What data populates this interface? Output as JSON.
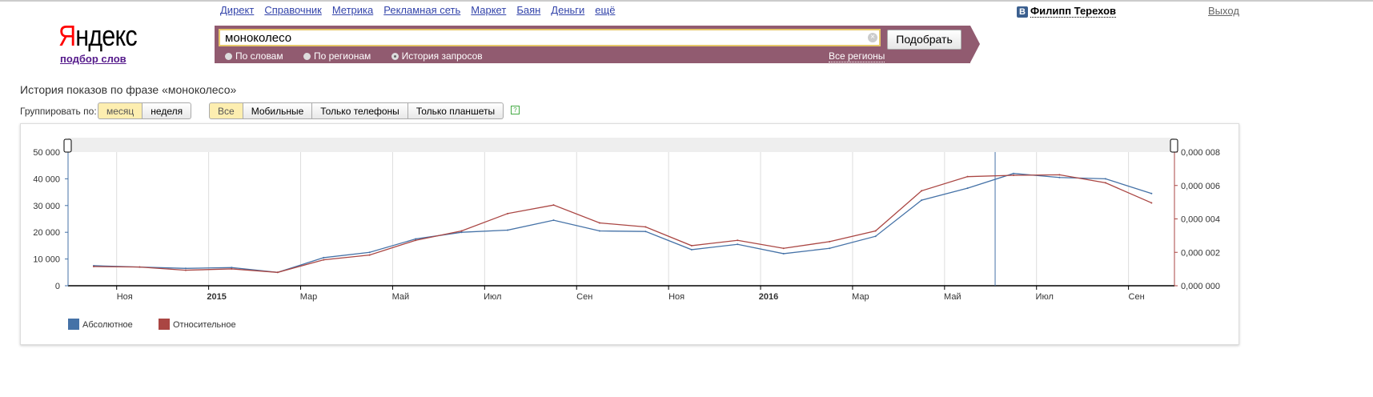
{
  "header": {
    "links": [
      "Директ",
      "Справочник",
      "Метрика",
      "Рекламная сеть",
      "Маркет",
      "Баян",
      "Деньги",
      "ещё"
    ],
    "logo": "Яндекс",
    "logo_first": "Я",
    "logo_rest": "ндекс",
    "subtitle": "подбор слов",
    "user": "Филипп Терехов",
    "vk_icon": "В",
    "logout": "Выход"
  },
  "search": {
    "value": "моноколесо",
    "button": "Подобрать",
    "clear_icon": "×",
    "modes": [
      {
        "label": "По словам",
        "selected": false
      },
      {
        "label": "По регионам",
        "selected": false
      },
      {
        "label": "История запросов",
        "selected": true
      }
    ],
    "regions": "Все регионы"
  },
  "page": {
    "title": "История показов по фразе «моноколесо»",
    "group_label": "Группировать по:",
    "group": [
      "месяц",
      "неделя"
    ],
    "devices": [
      "Все",
      "Мобильные",
      "Только телефоны",
      "Только планшеты"
    ],
    "help": "?"
  },
  "chart_data": {
    "type": "line",
    "x": [
      "2014-10",
      "2014-11",
      "2014-12",
      "2015-01",
      "2015-02",
      "2015-03",
      "2015-04",
      "2015-05",
      "2015-06",
      "2015-07",
      "2015-08",
      "2015-09",
      "2015-10",
      "2015-11",
      "2015-12",
      "2016-01",
      "2016-02",
      "2016-03",
      "2016-04",
      "2016-05",
      "2016-06",
      "2016-07",
      "2016-08",
      "2016-09"
    ],
    "x_ticks": [
      {
        "month": 1,
        "label": "Ноя",
        "bold": false
      },
      {
        "month": 3,
        "label": "2015",
        "bold": true
      },
      {
        "month": 5,
        "label": "Мар",
        "bold": false
      },
      {
        "month": 7,
        "label": "Май",
        "bold": false
      },
      {
        "month": 9,
        "label": "Июл",
        "bold": false
      },
      {
        "month": 11,
        "label": "Сен",
        "bold": false
      },
      {
        "month": 13,
        "label": "Ноя",
        "bold": false
      },
      {
        "month": 15,
        "label": "2016",
        "bold": true
      },
      {
        "month": 17,
        "label": "Мар",
        "bold": false
      },
      {
        "month": 19,
        "label": "Май",
        "bold": false
      },
      {
        "month": 21,
        "label": "Июл",
        "bold": false
      },
      {
        "month": 23,
        "label": "Сен",
        "bold": false
      }
    ],
    "y_left": {
      "range": [
        0,
        50000
      ],
      "ticks": [
        "0",
        "10 000",
        "20 000",
        "30 000",
        "40 000",
        "50 000"
      ]
    },
    "y_right": {
      "range": [
        0,
        0.008
      ],
      "ticks": [
        "0,000 000",
        "0,000 002",
        "0,000 004",
        "0,000 006",
        "0,000 008"
      ]
    },
    "series": [
      {
        "name": "Абсолютное",
        "axis": "left",
        "color": "#4572a7",
        "values": [
          7500,
          7000,
          6500,
          6800,
          5000,
          10500,
          12500,
          17500,
          20000,
          20800,
          24500,
          20500,
          20300,
          13500,
          15500,
          12000,
          14000,
          18500,
          32000,
          36500,
          42000,
          40500,
          40000,
          34500
        ]
      },
      {
        "name": "Относительное",
        "axis": "right",
        "color": "#aa4643",
        "values": [
          0.00115,
          0.00112,
          0.00093,
          0.00101,
          0.0008,
          0.00155,
          0.00184,
          0.00272,
          0.00328,
          0.00432,
          0.00483,
          0.00376,
          0.00352,
          0.0024,
          0.00272,
          0.00224,
          0.00264,
          0.00328,
          0.00568,
          0.00653,
          0.00661,
          0.00664,
          0.00616,
          0.00496
        ]
      }
    ],
    "cursor_month": 19.6,
    "legend": "bottom-left",
    "grid": true
  }
}
